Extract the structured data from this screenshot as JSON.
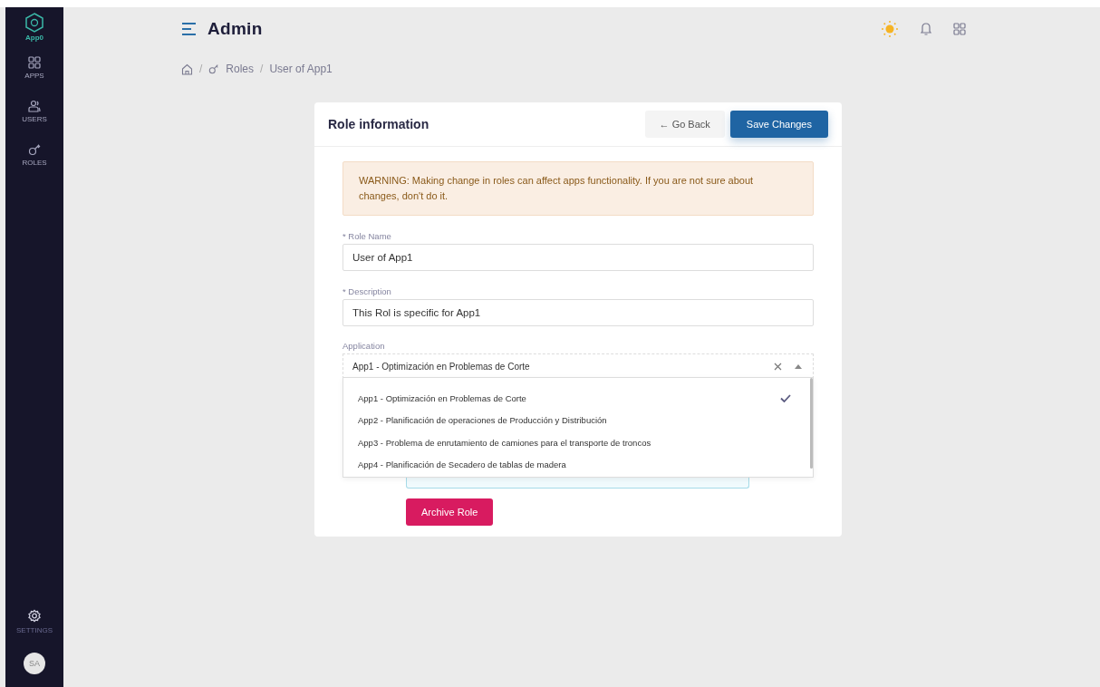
{
  "sidebar": {
    "logo_label": "App0",
    "items": [
      {
        "label": "APPS",
        "selected": false
      },
      {
        "label": "USERS",
        "selected": false
      },
      {
        "label": "ROLES",
        "selected": false
      }
    ],
    "settings": {
      "label": "SETTINGS"
    },
    "avatar": "SA"
  },
  "header": {
    "title": "Admin"
  },
  "breadcrumb": [
    {
      "separator": "/",
      "label": "Roles"
    },
    {
      "separator": "/",
      "label": "User of App1"
    }
  ],
  "card": {
    "title": "Role information",
    "go_back": "← Go Back",
    "save": "Save Changes",
    "warning": "WARNING: Making change in roles can affect apps functionality. If you are not sure about changes, don't do it.",
    "fields": [
      {
        "label": "* Role Name",
        "value": "User of App1"
      },
      {
        "label": "* Description",
        "value": "This Rol is specific for App1"
      }
    ],
    "application": {
      "label": "Application",
      "value": "App1 - Optimización en Problemas de Corte",
      "expanded": true,
      "options": [
        {
          "label": "App1 - Optimización en Problemas de Corte",
          "selected": true
        },
        {
          "label": "App2 - Planificación de operaciones de Producción y Distribución",
          "selected": false
        },
        {
          "label": "App3 - Problema de enrutamiento de camiones para el transporte de troncos",
          "selected": false
        },
        {
          "label": "App4 - Planificación de Secadero de tablas de madera",
          "selected": false
        }
      ]
    },
    "archive": "Archive Role"
  }
}
